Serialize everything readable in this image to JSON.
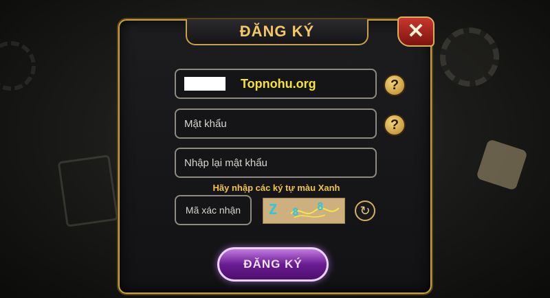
{
  "dialog": {
    "title": "ĐĂNG KÝ",
    "close_glyph": "✕"
  },
  "fields": {
    "username": {
      "value_mask": "",
      "watermark": "Topnohu.org"
    },
    "password": {
      "placeholder": "Mật khẩu"
    },
    "confirm_password": {
      "placeholder": "Nhập lại mật khẩu"
    }
  },
  "help_icon": "?",
  "captcha": {
    "hint": "Hãy nhập các ký tự màu Xanh",
    "input_placeholder": "Mã xác nhận",
    "chars": [
      "Z",
      "8",
      "8"
    ],
    "refresh_icon": "↻"
  },
  "submit_label": "ĐĂNG KÝ",
  "colors": {
    "gold_accent": "#c9a24a",
    "title_gold": "#f3c768",
    "hint_yellow": "#f2c54a",
    "watermark_yellow": "#f5e23a",
    "button_purple": "#6a1c93",
    "close_red": "#c7362e"
  }
}
